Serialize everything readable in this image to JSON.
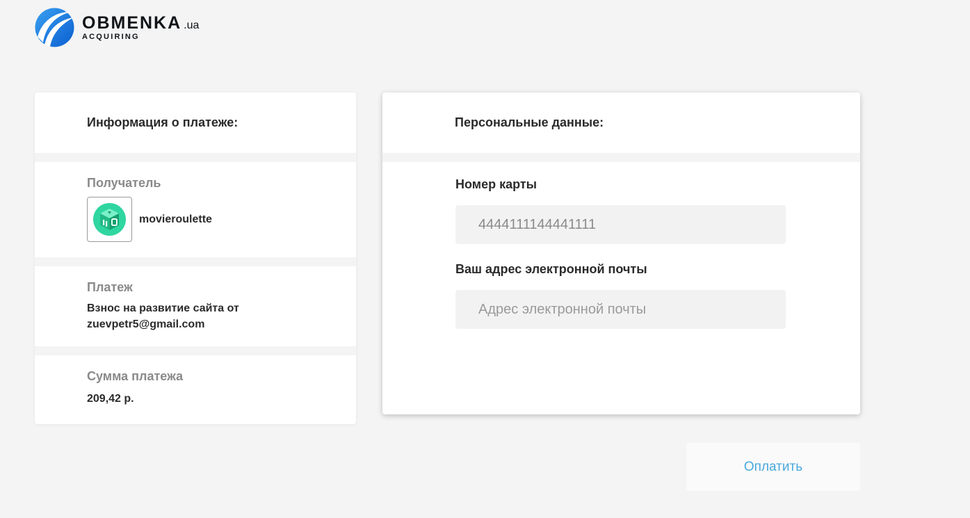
{
  "logo": {
    "name": "OBMENKA",
    "tld": ".ua",
    "subtitle": "ACQUIRING"
  },
  "payment_info": {
    "title": "Информация о платеже:",
    "recipient_label": "Получатель",
    "recipient_name": "movieroulette",
    "payment_label": "Платеж",
    "payment_line1": "Взнос на развитие сайта от",
    "payment_line2": "zuevpetr5@gmail.com",
    "amount_label": "Сумма платежа",
    "amount_value": "209,42 р."
  },
  "personal": {
    "title": "Персональные данные:",
    "card_label": "Номер карты",
    "card_value": "4444111144441111",
    "email_label": "Ваш адрес электронной почты",
    "email_placeholder": "Адрес электронной почты"
  },
  "pay_button": "Оплатить",
  "colors": {
    "background": "#f4f4f4",
    "accent_blue": "#4aa8dd",
    "avatar_green": "#2fd6a0",
    "field_bg": "#f2f2f2"
  }
}
